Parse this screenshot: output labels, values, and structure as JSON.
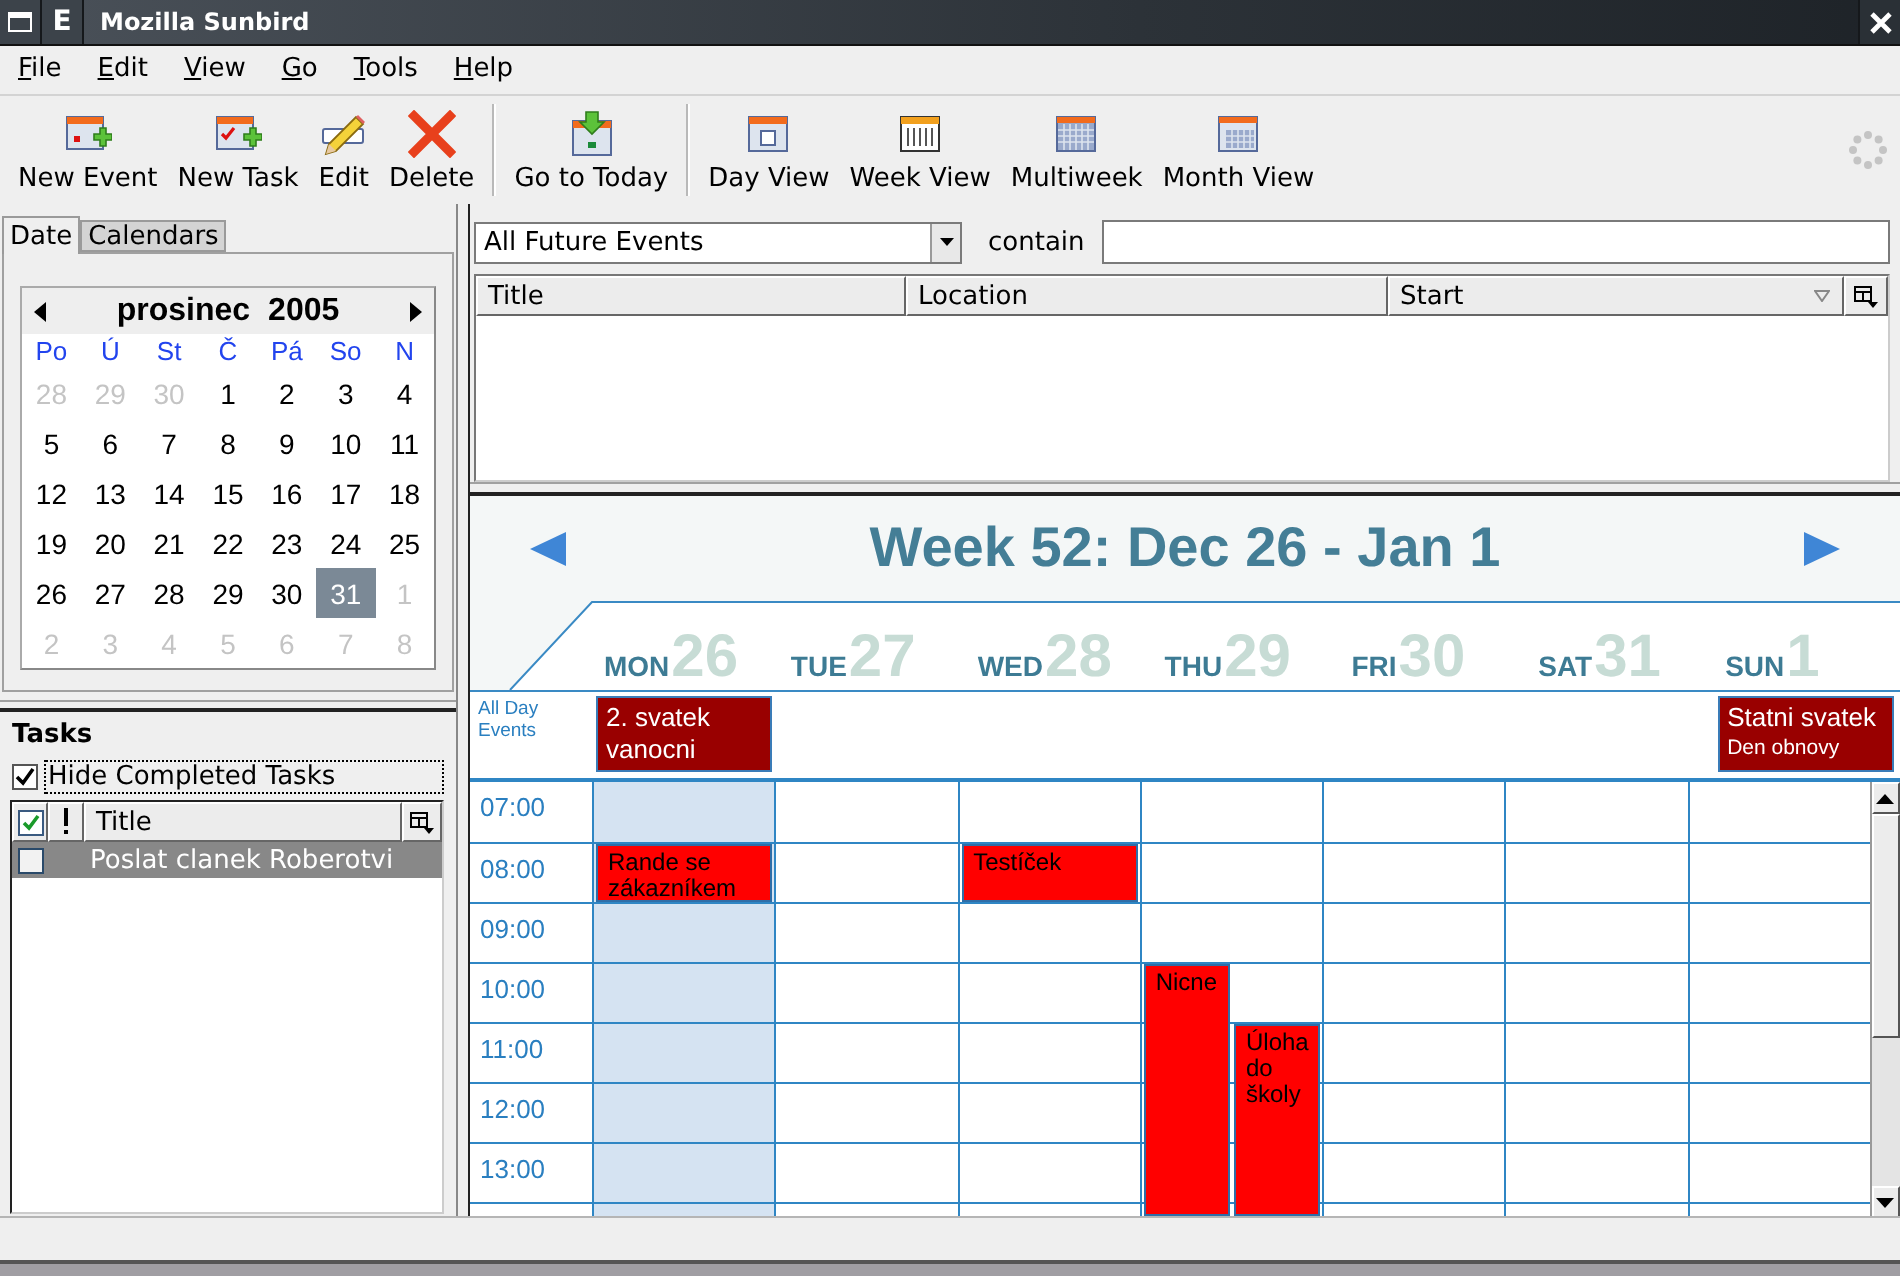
{
  "window": {
    "title": "Mozilla Sunbird",
    "menu_glyph": "E"
  },
  "menu": [
    "File",
    "Edit",
    "View",
    "Go",
    "Tools",
    "Help"
  ],
  "toolbar": [
    [
      {
        "label": "New Event",
        "kind": "event"
      },
      {
        "label": "New Task",
        "kind": "task"
      },
      {
        "label": "Edit",
        "kind": "edit"
      },
      {
        "label": "Delete",
        "kind": "delete"
      }
    ],
    [
      {
        "label": "Go to Today",
        "kind": "today"
      }
    ],
    [
      {
        "label": "Day View",
        "kind": "day"
      },
      {
        "label": "Week View",
        "kind": "week"
      },
      {
        "label": "Multiweek",
        "kind": "multiweek"
      },
      {
        "label": "Month View",
        "kind": "month"
      }
    ]
  ],
  "sidebar": {
    "tabs": [
      {
        "label": "Date",
        "selected": true
      },
      {
        "label": "Calendars",
        "selected": false
      }
    ],
    "minimonth": {
      "month": "prosinec",
      "year": "2005",
      "weekdays": [
        "Po",
        "Ú",
        "St",
        "Č",
        "Pá",
        "So",
        "N"
      ],
      "weeks": [
        [
          {
            "d": "28",
            "outside": true,
            "selected": false
          },
          {
            "d": "29",
            "outside": true,
            "selected": false
          },
          {
            "d": "30",
            "outside": true,
            "selected": false
          },
          {
            "d": "1",
            "outside": false,
            "selected": false
          },
          {
            "d": "2",
            "outside": false,
            "selected": false
          },
          {
            "d": "3",
            "outside": false,
            "selected": false
          },
          {
            "d": "4",
            "outside": false,
            "selected": false
          }
        ],
        [
          {
            "d": "5",
            "outside": false,
            "selected": false
          },
          {
            "d": "6",
            "outside": false,
            "selected": false
          },
          {
            "d": "7",
            "outside": false,
            "selected": false
          },
          {
            "d": "8",
            "outside": false,
            "selected": false
          },
          {
            "d": "9",
            "outside": false,
            "selected": false
          },
          {
            "d": "10",
            "outside": false,
            "selected": false
          },
          {
            "d": "11",
            "outside": false,
            "selected": false
          }
        ],
        [
          {
            "d": "12",
            "outside": false,
            "selected": false
          },
          {
            "d": "13",
            "outside": false,
            "selected": false
          },
          {
            "d": "14",
            "outside": false,
            "selected": false
          },
          {
            "d": "15",
            "outside": false,
            "selected": false
          },
          {
            "d": "16",
            "outside": false,
            "selected": false
          },
          {
            "d": "17",
            "outside": false,
            "selected": false
          },
          {
            "d": "18",
            "outside": false,
            "selected": false
          }
        ],
        [
          {
            "d": "19",
            "outside": false,
            "selected": false
          },
          {
            "d": "20",
            "outside": false,
            "selected": false
          },
          {
            "d": "21",
            "outside": false,
            "selected": false
          },
          {
            "d": "22",
            "outside": false,
            "selected": false
          },
          {
            "d": "23",
            "outside": false,
            "selected": false
          },
          {
            "d": "24",
            "outside": false,
            "selected": false
          },
          {
            "d": "25",
            "outside": false,
            "selected": false
          }
        ],
        [
          {
            "d": "26",
            "outside": false,
            "selected": false
          },
          {
            "d": "27",
            "outside": false,
            "selected": false
          },
          {
            "d": "28",
            "outside": false,
            "selected": false
          },
          {
            "d": "29",
            "outside": false,
            "selected": false
          },
          {
            "d": "30",
            "outside": false,
            "selected": false
          },
          {
            "d": "31",
            "outside": false,
            "selected": true
          },
          {
            "d": "1",
            "outside": true,
            "selected": false
          }
        ],
        [
          {
            "d": "2",
            "outside": true,
            "selected": false
          },
          {
            "d": "3",
            "outside": true,
            "selected": false
          },
          {
            "d": "4",
            "outside": true,
            "selected": false
          },
          {
            "d": "5",
            "outside": true,
            "selected": false
          },
          {
            "d": "6",
            "outside": true,
            "selected": false
          },
          {
            "d": "7",
            "outside": true,
            "selected": false
          },
          {
            "d": "8",
            "outside": true,
            "selected": false
          }
        ]
      ]
    },
    "tasks": {
      "title": "Tasks",
      "hide_completed": {
        "label": "Hide Completed Tasks",
        "checked": true
      },
      "columns": [
        "Title"
      ],
      "items": [
        {
          "title": "Poslat clanek Roberotvi",
          "completed": false,
          "selected": true
        }
      ]
    }
  },
  "events_list": {
    "filter": {
      "value": "All Future Events"
    },
    "contain_label": "contain",
    "columns": [
      {
        "label": "Title",
        "sorted": false
      },
      {
        "label": "Location",
        "sorted": false
      },
      {
        "label": "Start",
        "sorted": true
      }
    ]
  },
  "week_view": {
    "title": "Week 52: Dec 26 - Jan 1",
    "all_day_label": "All Day Events",
    "hours": [
      "07:00",
      "08:00",
      "09:00",
      "10:00",
      "11:00",
      "12:00",
      "13:00"
    ],
    "days": [
      {
        "name": "MON",
        "number": "26",
        "selected": true,
        "all_day": [
          {
            "title": "2. svatek vanocni"
          }
        ],
        "slots": [
          {
            "kind": "free"
          },
          {
            "kind": "event",
            "title": "Rande se zákazníkem"
          },
          {
            "kind": "free"
          },
          {
            "kind": "free"
          },
          {
            "kind": "free"
          },
          {
            "kind": "free"
          },
          {
            "kind": "free"
          }
        ]
      },
      {
        "name": "TUE",
        "number": "27",
        "selected": false,
        "slots": [
          {
            "kind": "free"
          },
          {
            "kind": "free"
          },
          {
            "kind": "free"
          },
          {
            "kind": "free"
          },
          {
            "kind": "free"
          },
          {
            "kind": "free"
          },
          {
            "kind": "free"
          }
        ]
      },
      {
        "name": "WED",
        "number": "28",
        "selected": false,
        "slots": [
          {
            "kind": "free"
          },
          {
            "kind": "event",
            "title": "Testíček"
          },
          {
            "kind": "free"
          },
          {
            "kind": "free"
          },
          {
            "kind": "free"
          },
          {
            "kind": "free"
          },
          {
            "kind": "free"
          }
        ]
      },
      {
        "name": "THU",
        "number": "29",
        "selected": false,
        "slots": [
          {
            "kind": "free"
          },
          {
            "kind": "free"
          },
          {
            "kind": "free"
          },
          {
            "kind": "event",
            "title": "Nicne",
            "continues_below": true
          },
          {
            "kind": "event",
            "title": "Úloha do školy",
            "continues_below": true
          },
          {
            "kind": "free"
          },
          {
            "kind": "free"
          }
        ]
      },
      {
        "name": "FRI",
        "number": "30",
        "selected": false,
        "slots": [
          {
            "kind": "free"
          },
          {
            "kind": "free"
          },
          {
            "kind": "free"
          },
          {
            "kind": "free"
          },
          {
            "kind": "free"
          },
          {
            "kind": "free"
          },
          {
            "kind": "free"
          }
        ]
      },
      {
        "name": "SAT",
        "number": "31",
        "selected": false,
        "slots": [
          {
            "kind": "free"
          },
          {
            "kind": "free"
          },
          {
            "kind": "free"
          },
          {
            "kind": "free"
          },
          {
            "kind": "free"
          },
          {
            "kind": "free"
          },
          {
            "kind": "free"
          }
        ]
      },
      {
        "name": "SUN",
        "number": "1",
        "selected": false,
        "all_day": [
          {
            "title": "Statni svatek",
            "description": "Den obnovy"
          }
        ],
        "slots": [
          {
            "kind": "free"
          },
          {
            "kind": "free"
          },
          {
            "kind": "free"
          },
          {
            "kind": "free"
          },
          {
            "kind": "free"
          },
          {
            "kind": "free"
          },
          {
            "kind": "free"
          }
        ]
      }
    ]
  }
}
